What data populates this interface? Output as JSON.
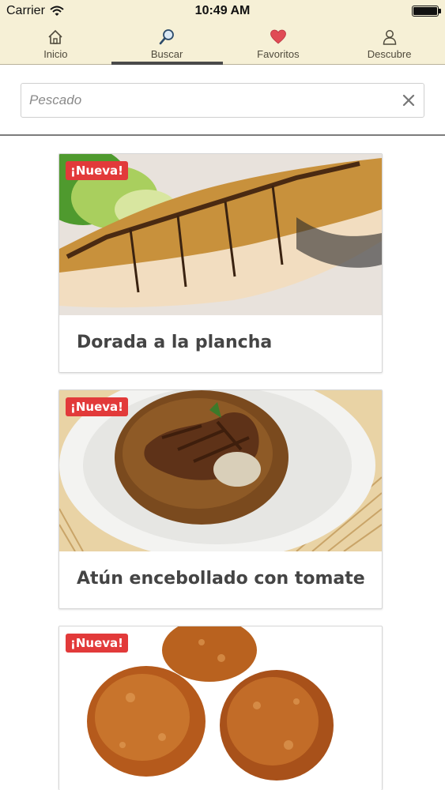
{
  "status_bar": {
    "carrier": "Carrier",
    "time": "10:49 AM"
  },
  "tabs": [
    {
      "label": "Inicio",
      "icon": "home-icon",
      "active": false
    },
    {
      "label": "Buscar",
      "icon": "search-icon",
      "active": true
    },
    {
      "label": "Favoritos",
      "icon": "heart-icon",
      "active": false
    },
    {
      "label": "Descubre",
      "icon": "user-icon",
      "active": false
    }
  ],
  "search": {
    "value": "",
    "placeholder": "Pescado",
    "clear_icon": "close-icon"
  },
  "colors": {
    "header_bg": "#f6f0d6",
    "badge_bg": "#e23a3a",
    "heart": "#e04b55"
  },
  "recipes": [
    {
      "badge": "¡Nueva!",
      "title": "Dorada a la plancha"
    },
    {
      "badge": "¡Nueva!",
      "title": "Atún encebollado con tomate"
    },
    {
      "badge": "¡Nueva!",
      "title": ""
    }
  ]
}
